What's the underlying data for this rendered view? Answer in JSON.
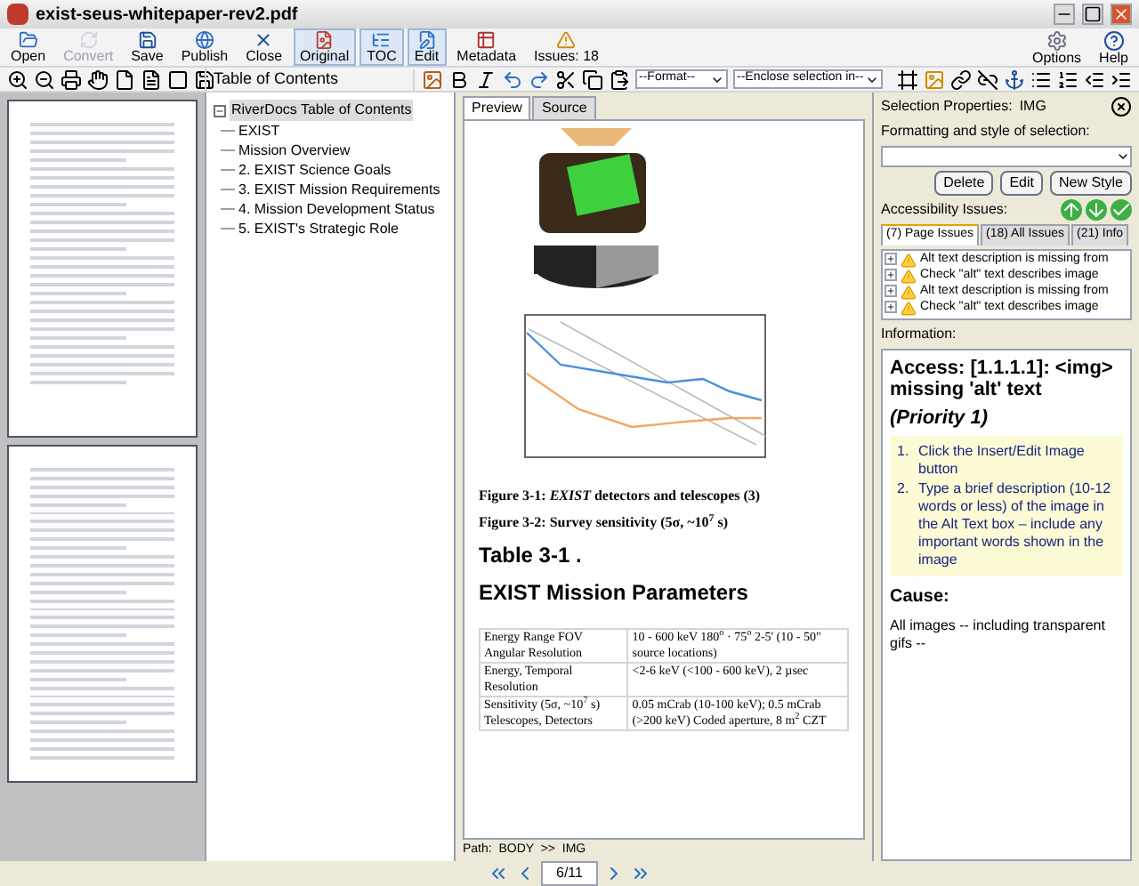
{
  "window": {
    "title": "exist-seus-whitepaper-rev2.pdf"
  },
  "toolbar": [
    {
      "label": "Open",
      "kind": "open",
      "selected": false,
      "disabled": false
    },
    {
      "label": "Convert",
      "kind": "convert",
      "selected": false,
      "disabled": true
    },
    {
      "label": "Save",
      "kind": "save",
      "selected": false,
      "disabled": false
    },
    {
      "label": "Publish",
      "kind": "publish",
      "selected": false,
      "disabled": false
    },
    {
      "label": "Close",
      "kind": "close",
      "selected": false,
      "disabled": false
    },
    {
      "label": "Original",
      "kind": "original",
      "selected": true,
      "disabled": false
    },
    {
      "label": "TOC",
      "kind": "toc",
      "selected": true,
      "disabled": false
    },
    {
      "label": "Edit",
      "kind": "edit",
      "selected": true,
      "disabled": false
    },
    {
      "label": "Metadata",
      "kind": "metadata",
      "selected": false,
      "disabled": false
    },
    {
      "label": "Issues: 18",
      "kind": "issues",
      "selected": false,
      "disabled": false
    }
  ],
  "toolbar_right": [
    {
      "label": "Options",
      "kind": "options"
    },
    {
      "label": "Help",
      "kind": "help"
    }
  ],
  "toc": {
    "title": "Table of Contents",
    "root": {
      "label": "RiverDocs Table of Contents",
      "expanded": true,
      "selected": true,
      "children": [
        {
          "label": "EXIST",
          "selected": false
        },
        {
          "label": "Mission Overview",
          "selected": false
        },
        {
          "label": "2. EXIST Science Goals",
          "selected": false
        },
        {
          "label": "3. EXIST Mission Requirements",
          "selected": false
        },
        {
          "label": "4. Mission Development Status",
          "selected": false
        },
        {
          "label": "5. EXIST's Strategic Role",
          "selected": false
        }
      ]
    }
  },
  "editor": {
    "format_select": "--Format--",
    "enclose_select": "--Enclose selection in--",
    "tabs": [
      {
        "label": "Preview",
        "selected": true
      },
      {
        "label": "Source",
        "selected": false
      }
    ],
    "captions": [
      "Figure 3-1: *EXIST* detectors and telescopes (3)",
      "Figure 3-2: Survey sensitivity (5σ, ~10$^{7}$ s)"
    ],
    "table_title": "Table 3-1 .",
    "table_heading": "EXIST Mission Parameters",
    "table_rows": [
      [
        "Energy Range FOV Angular Resolution",
        "10 - 600 keV 180$^{o}$ · 75$^{o}$ 2-5' (10 - 50\" source locations)"
      ],
      [
        "Energy, Temporal Resolution",
        "<2-6 keV (<100 - 600 keV), 2 µsec"
      ],
      [
        "Sensitivity (5σ, ~10$^{7}$ s) Telescopes, Detectors",
        "0.05 mCrab (10-100 keV); 0.5 mCrab (>200 keV) Coded aperture, 8 m$^{2}$ CZT"
      ]
    ],
    "path": "Path:  BODY  >>  IMG"
  },
  "properties": {
    "title": "Selection Properties:",
    "element": "IMG",
    "style_label": "Formatting and style of selection:",
    "buttons": [
      "Delete",
      "Edit",
      "New Style"
    ],
    "issues_label": "Accessibility Issues:",
    "issue_tabs": [
      {
        "label": "(7) Page Issues",
        "selected": true
      },
      {
        "label": "(18) All Issues",
        "selected": false
      },
      {
        "label": "(21) Info",
        "selected": false
      }
    ],
    "issues": [
      {
        "text": "Alt text description is missing from",
        "expanded": false
      },
      {
        "text": "Check \"alt\" text describes image",
        "expanded": false
      },
      {
        "text": "Alt text description is missing from",
        "expanded": false
      },
      {
        "text": "Check \"alt\" text describes image",
        "expanded": false
      }
    ],
    "info_label": "Information:",
    "info_title": "Access: [1.1.1.1]: <img> missing 'alt' text",
    "info_priority": "(Priority 1)",
    "steps": [
      {
        "number": "1.",
        "text": "Click the Insert/Edit Image button"
      },
      {
        "number": "2.",
        "text": "Type a brief description (10-12 words or less) of the image in the Alt Text box – include any important words shown in the image"
      }
    ],
    "cause_label": "Cause:",
    "cause_text": "All images -- including transparent gifs --"
  },
  "pager": {
    "page": "6/11"
  }
}
